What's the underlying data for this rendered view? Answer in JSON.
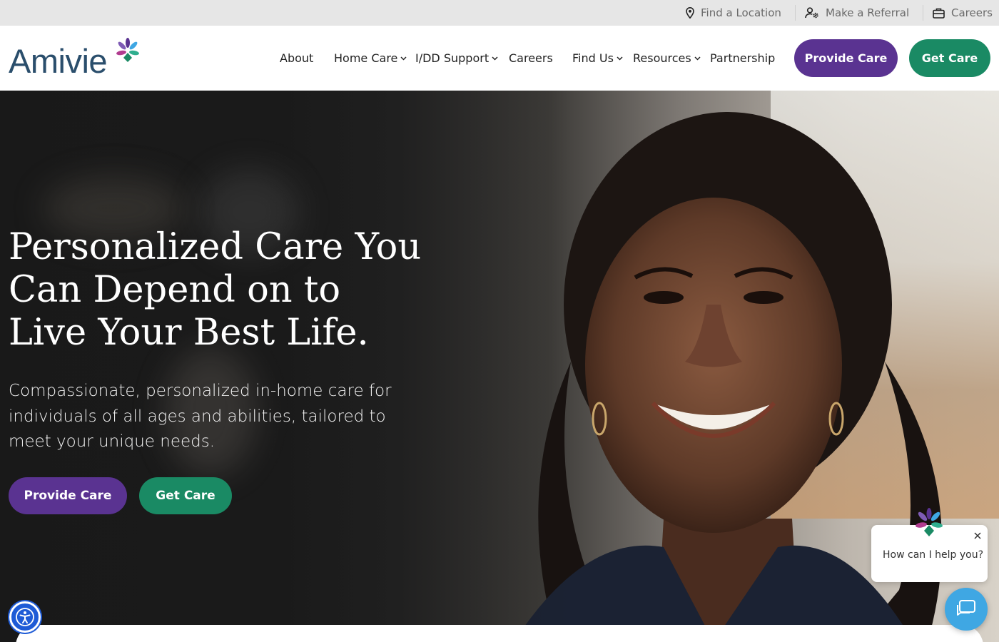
{
  "utility": {
    "find_location": "Find a Location",
    "make_referral": "Make a Referral",
    "careers": "Careers"
  },
  "brand": {
    "logo_text": "Amivie",
    "colors": {
      "purple": "#5a3391",
      "green": "#1a8a64",
      "navy": "#2a4e6c",
      "chat_blue": "#3fa7e3",
      "a11y_blue": "#1e5bd6"
    }
  },
  "nav": {
    "about": "About",
    "home_care": "Home Care",
    "idd_support": "I/DD Support",
    "careers": "Careers",
    "find_us": "Find Us",
    "resources": "Resources",
    "partnership": "Partnership",
    "provide_care": "Provide Care",
    "get_care": "Get Care"
  },
  "hero": {
    "title_lines": [
      "Personalized Care You",
      "Can Depend on to",
      "Live Your Best Life."
    ],
    "subtitle": "Compassionate, personalized in-home care for individuals of all ages and abilities, tailored to meet your unique needs.",
    "provide_care": "Provide Care",
    "get_care": "Get Care"
  },
  "chat": {
    "prompt": "How can I help you?"
  },
  "icons": [
    "location-pin-icon",
    "user-gear-icon",
    "briefcase-icon",
    "chevron-down-icon",
    "accessibility-icon",
    "close-icon",
    "chat-icon",
    "logo-mark-icon"
  ]
}
